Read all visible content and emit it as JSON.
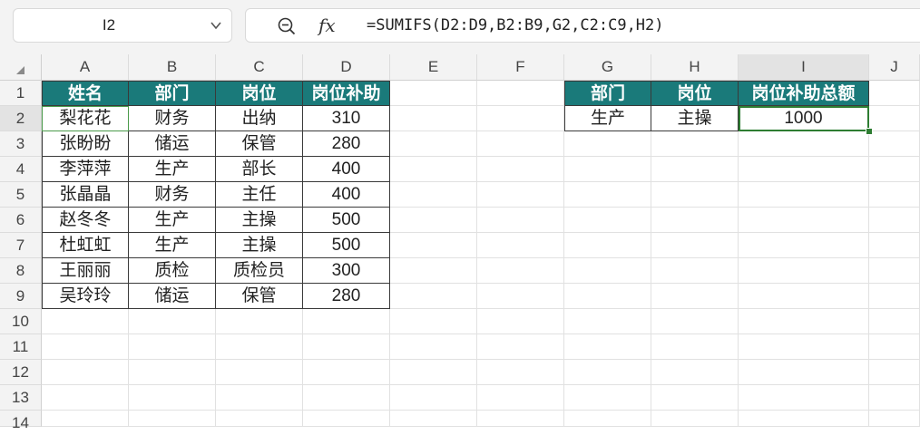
{
  "name_box": {
    "value": "I2"
  },
  "formula_bar": {
    "formula": "=SUMIFS(D2:D9,B2:B9,G2,C2:C9,H2)",
    "fx_label": "fx"
  },
  "columns": [
    "A",
    "B",
    "C",
    "D",
    "E",
    "F",
    "G",
    "H",
    "I",
    "J"
  ],
  "rows": [
    "1",
    "2",
    "3",
    "4",
    "5",
    "6",
    "7",
    "8",
    "9",
    "10",
    "11",
    "12",
    "13",
    "14"
  ],
  "table1": {
    "headers": [
      "姓名",
      "部门",
      "岗位",
      "岗位补助"
    ],
    "rows": [
      [
        "梨花花",
        "财务",
        "出纳",
        "310"
      ],
      [
        "张盼盼",
        "储运",
        "保管",
        "280"
      ],
      [
        "李萍萍",
        "生产",
        "部长",
        "400"
      ],
      [
        "张晶晶",
        "财务",
        "主任",
        "400"
      ],
      [
        "赵冬冬",
        "生产",
        "主操",
        "500"
      ],
      [
        "杜虹虹",
        "生产",
        "主操",
        "500"
      ],
      [
        "王丽丽",
        "质检",
        "质检员",
        "300"
      ],
      [
        "吴玲玲",
        "储运",
        "保管",
        "280"
      ]
    ]
  },
  "table2": {
    "headers": [
      "部门",
      "岗位",
      "岗位补助总额"
    ],
    "row": [
      "生产",
      "主操",
      "1000"
    ]
  },
  "colors": {
    "header_bg": "#1a7a7a",
    "selection": "#2e7d32"
  }
}
